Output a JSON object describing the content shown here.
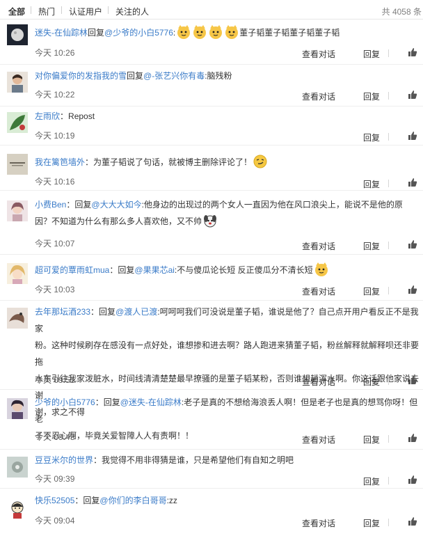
{
  "tabs": {
    "all": "全部",
    "hot": "热门",
    "verified": "认证用户",
    "following": "关注的人"
  },
  "total": "共 4058 条",
  "actions": {
    "view_conversation": "查看对话",
    "reply": "回复"
  },
  "comments": [
    {
      "prefix": "回复",
      "user": "迷失-在仙踪林",
      "mention": "@少爷的小白5776",
      "body": "董子韬董子韬董子韬董子韬",
      "emoji_name": "doge-cat-emoji",
      "time": "今天 10:26",
      "colors": {
        "avatar": "#2a2f3a"
      }
    },
    {
      "prefix": "回复",
      "user": "对你偏爱你的发指我的雪",
      "mention": "@-张艺兴你有毒",
      "body": ":脑残粉",
      "time": "今天 10:22",
      "colors": {
        "avatar": "#8a6a55"
      }
    },
    {
      "user": "左雨欣",
      "body": "Repost",
      "time": "今天 10:19",
      "colors": {
        "avatar": "#3e7a3a"
      }
    },
    {
      "user": "我在篱笆墙外",
      "body": "为董子韬说了句话，就被博主删除评论了！",
      "emoji_name": "smirk-emoji",
      "time": "今天 10:16",
      "colors": {
        "avatar": "#cfc8b8"
      }
    },
    {
      "prefix": "回复",
      "user": "小费Ben",
      "mention": "@大大大如今",
      "body_line1": ":他身边的出现过的两个女人一直因为他在风口浪尖上，能说不是他的原",
      "body_line2": "因？不知道为什么有那么多人喜欢他，又不帅",
      "emoji_name": "dog-emoji",
      "time": "今天 10:07",
      "colors": {
        "avatar": "#b9a0a6"
      }
    },
    {
      "prefix": "回复",
      "user": "超可爱的覃雨虹mua",
      "mention": "@果果芯ai",
      "body": ":不与傻瓜论长短 反正傻瓜分不清长短",
      "emoji_name": "doge-cat-emoji",
      "time": "今天 10:03",
      "colors": {
        "avatar": "#e6c58a"
      }
    },
    {
      "prefix": "回复",
      "user": "去年那坛酒233",
      "mention": "@渡人已渡",
      "body_line1": ":呵呵呵我们可没说是董子韬，谁说是他了？自己点开用户看反正不是我家",
      "body_line2": "粉。这种时候刷存在感没有一点好处，谁想掺和进去啊？路人跑进来猜董子韬，粉丝解释就解释呗还非要拖",
      "body_line3": "水东引往我家泼脏水，时间线清清楚楚最早撩骚的是董子韬某粉，否则谁想趟浑水啊。你这话跟他家说去谢",
      "body_line4": "谢，求之不得",
      "time": "今天 09:51",
      "colors": {
        "avatar": "#7a5a4a"
      }
    },
    {
      "prefix": "回复",
      "user": "少爷的小白5776",
      "mention": "@迷失-在仙踪林",
      "body_line1": ":老子是真的不想给海浪丢人啊！但是老子也是真的想骂你呀！但老",
      "body_line2": "子不忍心啊，毕竟关爱智障人人有责啊！！",
      "time": "今天 09:43",
      "colors": {
        "avatar": "#5b4b6e"
      }
    },
    {
      "user": "豆豆米尔的世界",
      "body": "我觉得不用非得猜是谁，只是希望他们有自知之明吧",
      "time": "今天 09:39",
      "colors": {
        "avatar": "#9aa6a0"
      }
    },
    {
      "prefix": "回复",
      "user": "快乐52505",
      "mention": "@你们的李白哥哥",
      "body": ":zz",
      "time": "今天 09:04",
      "colors": {
        "avatar": "#f2f2f2"
      }
    }
  ]
}
